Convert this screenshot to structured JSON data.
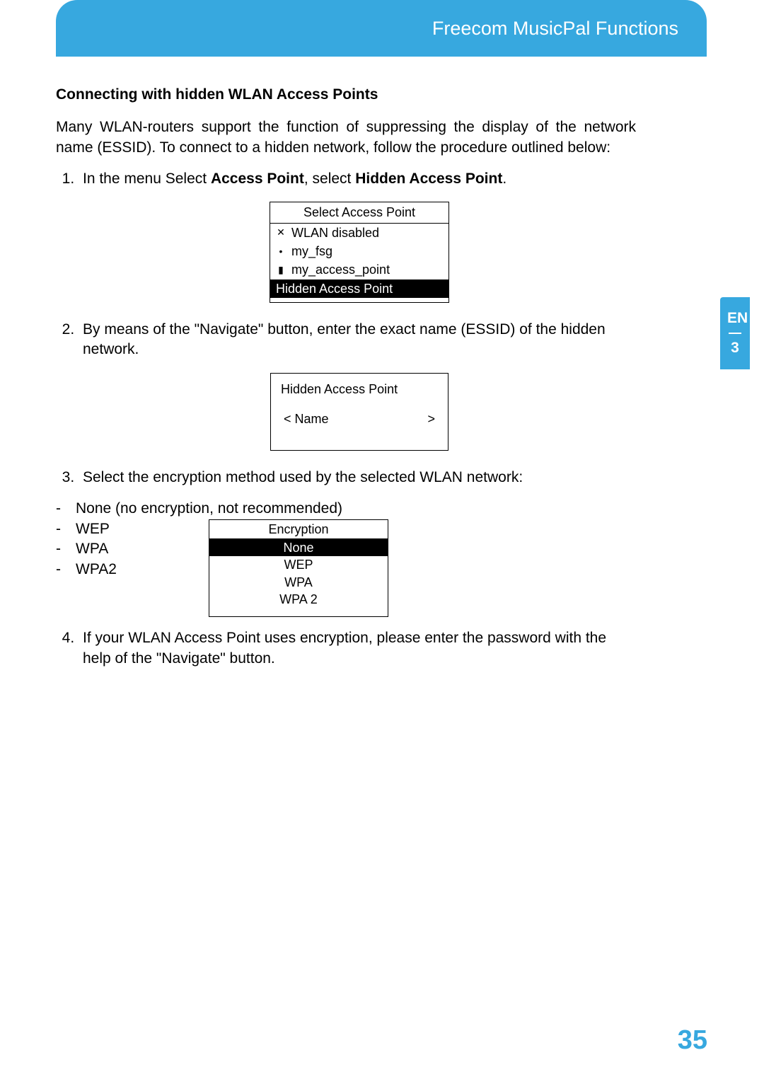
{
  "header": {
    "title": "Freecom MusicPal Functions"
  },
  "section": {
    "heading": "Connecting with hidden WLAN Access Points",
    "intro": "Many WLAN-routers support the function of suppressing the display of the network name (ESSID). To connect to a hidden network, follow the procedure  outlined below:"
  },
  "step1": {
    "prefix": "In the menu Select ",
    "bold1": "Access Point",
    "mid": ", select ",
    "bold2": "Hidden Access Point",
    "suffix": "."
  },
  "menu1": {
    "title": "Select Access Point",
    "items": [
      {
        "icon": "✕",
        "label": "WLAN disabled"
      },
      {
        "icon": "•",
        "label": "my_fsg"
      },
      {
        "icon": "▮",
        "label": "my_access_point"
      }
    ],
    "selected": "Hidden Access Point"
  },
  "step2": "By means of the \"Navigate\" button, enter the exact name (ESSID) of the hidden network.",
  "menu2": {
    "title": "Hidden Access Point",
    "lt": "<",
    "name": "Name",
    "gt": ">"
  },
  "step3": "Select the encryption method used by the selected WLAN network:",
  "enc_list": [
    "None (no encryption, not recommended)",
    "WEP",
    "WPA",
    "WPA2"
  ],
  "menu3": {
    "title": "Encryption",
    "items": [
      "None",
      "WEP",
      "WPA",
      "WPA 2"
    ],
    "selected_index": 0
  },
  "step4": "If your WLAN Access Point uses encryption, please enter the password with the help of the \"Navigate\" button.",
  "sidebar": {
    "lang": "EN",
    "chapter": "3"
  },
  "page_number": "35"
}
